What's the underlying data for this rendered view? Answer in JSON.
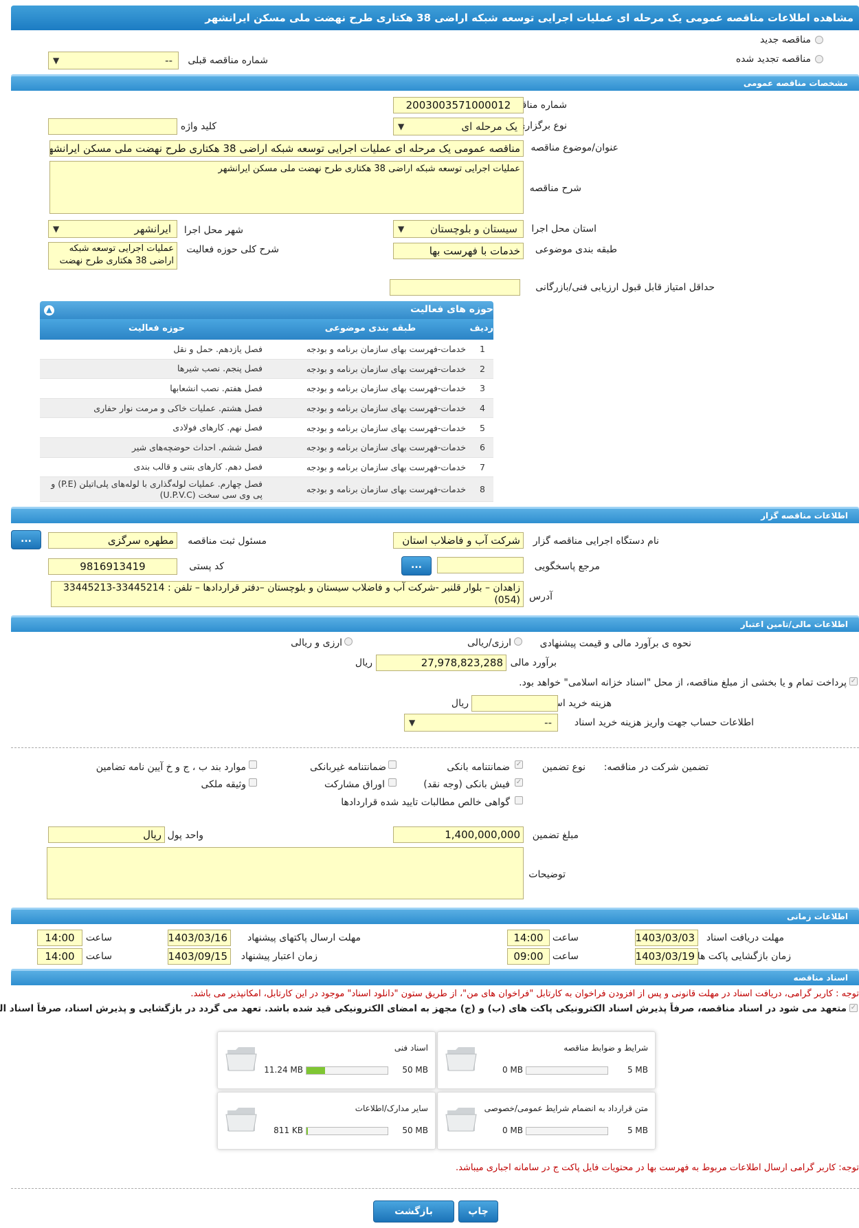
{
  "title": "مشاهده اطلاعات مناقصه عمومی یک مرحله ای عملیات اجرایی توسعه شبکه اراضی 38 هکتاری طرح نهضت ملی مسکن ایرانشهر",
  "top": {
    "new_tender": "مناقصه جدید",
    "renewed_tender": "مناقصه تجدید شده",
    "prev_number_label": "شماره مناقصه قبلی",
    "prev_number_value": "--"
  },
  "general": {
    "header": "مشخصات مناقصه عمومی",
    "number_label": "شماره مناقصه",
    "number_value": "2003003571000012",
    "type_label": "نوع برگزاری",
    "type_value": "یک مرحله ای",
    "keyword_label": "کلید واژه",
    "keyword_value": "",
    "subject_label": "عنوان/موضوع مناقصه",
    "subject_value": "مناقصه عمومی یک مرحله ای عملیات اجرایی توسعه شبکه اراضی 38 هکتاری طرح نهضت ملی مسکن ایرانشهر",
    "desc_label": "شرح مناقصه",
    "desc_value": "عملیات اجرایی توسعه شبکه اراضی 38 هکتاری طرح نهضت ملی مسکن ایرانشهر",
    "province_label": "استان محل اجرا",
    "province_value": "سیستان و بلوچستان",
    "city_label": "شهر محل اجرا",
    "city_value": "ایرانشهر",
    "category_label": "طبقه بندی موضوعی",
    "category_value": "خدمات با فهرست بها",
    "activity_desc_label": "شرح کلی حوزه فعالیت",
    "activity_desc_value": "عملیات اجرایی توسعه شبکه اراضی 38 هکتاری طرح نهضت",
    "min_score_label": "حداقل امتیاز قابل قبول ارزیابی فنی/بازرگانی",
    "min_score_value": ""
  },
  "activities": {
    "caption": "حوزه های فعالیت",
    "col_row": "ردیف",
    "col_category": "طبقه بندی موضوعی",
    "col_area": "حوزه فعالیت",
    "rows": [
      {
        "n": "1",
        "category": "خدمات-فهرست بهای سازمان برنامه و بودجه",
        "area": "فصل یازدهم. حمل و نقل"
      },
      {
        "n": "2",
        "category": "خدمات-فهرست بهای سازمان برنامه و بودجه",
        "area": "فصل پنجم. نصب شیرها"
      },
      {
        "n": "3",
        "category": "خدمات-فهرست بهای سازمان برنامه و بودجه",
        "area": "فصل هفتم. نصب انشعابها"
      },
      {
        "n": "4",
        "category": "خدمات-فهرست بهای سازمان برنامه و بودجه",
        "area": "فصل هشتم. عملیات خاکی و مرمت نوار حفاری"
      },
      {
        "n": "5",
        "category": "خدمات-فهرست بهای سازمان برنامه و بودجه",
        "area": "فصل نهم. کارهای فولادی"
      },
      {
        "n": "6",
        "category": "خدمات-فهرست بهای سازمان برنامه و بودجه",
        "area": "فصل ششم. احداث حوضچه‌های شیر"
      },
      {
        "n": "7",
        "category": "خدمات-فهرست بهای سازمان برنامه و بودجه",
        "area": "فصل دهم. کارهای بتنی و قالب بندی"
      },
      {
        "n": "8",
        "category": "خدمات-فهرست بهای سازمان برنامه و بودجه",
        "area": "فصل چهارم. عملیات لوله‌گذاری با لوله‌های پلی‌اتیلن (P.E) و پی وی سی سخت (U.P.V.C)"
      }
    ]
  },
  "organizer": {
    "header": "اطلاعات مناقصه گزار",
    "org_label": "نام دستگاه اجرایی مناقصه گزار",
    "org_value": "شرکت آب و فاضلاب استان",
    "responsible_label": "مسئول ثبت مناقصه",
    "responsible_value": "مطهره سرگزی",
    "ref_label": "مرجع پاسخگویی",
    "ref_value": "",
    "postal_label": "کد پستی",
    "postal_value": "9816913419",
    "address_label": "آدرس",
    "address_value": "زاهدان – بلوار قلنبر -شرکت آب و فاضلاب سیستان و بلوچستان –دفتر قراردادها –  تلفن : 33445214-33445213 (054)",
    "more_btn": "..."
  },
  "finance": {
    "header": "اطلاعات مالی/تامین اعتبار",
    "method_label": "نحوه ی برآورد مالی و قیمت پیشنهادی",
    "rial_option": "ارزی/ریالی",
    "fx_option": "ارزی و ریالی",
    "estimate_label": "برآورد مالی",
    "estimate_value": "27,978,823,288",
    "estimate_unit": "ریال",
    "treasury_note": "پرداخت تمام و یا بخشی از مبلغ مناقصه، از محل \"اسناد خزانه اسلامی\" خواهد بود.",
    "doc_cost_label": "هزینه خرید اسناد",
    "doc_cost_value": "",
    "doc_cost_unit": "ریال",
    "account_label": "اطلاعات حساب جهت واریز هزینه خرید اسناد",
    "account_value": "--"
  },
  "guarantee": {
    "label": "تضمین شرکت در مناقصه:",
    "type_label": "نوع تضمین",
    "opt_bank": "ضمانتنامه بانکی",
    "opt_nonbank": "ضمانتنامه غیربانکی",
    "opt_clauses": "موارد بند ب ، ج و خ آیین نامه تضامین",
    "opt_cash": "فیش بانکی (وجه نقد)",
    "opt_bonds": "اوراق مشارکت",
    "opt_property": "وثیقه ملکی",
    "opt_claims": "گواهی خالص مطالبات تایید شده قراردادها",
    "amount_label": "مبلغ تضمین",
    "amount_value": "1,400,000,000",
    "currency_label": "واحد پول",
    "currency_value": "ریال",
    "notes_label": "توضیحات",
    "notes_value": ""
  },
  "timing": {
    "header": "اطلاعات زمانی",
    "doc_receive_label": "مهلت دریافت اسناد",
    "doc_receive_date": "1403/03/03",
    "doc_receive_time": "14:00",
    "send_label": "مهلت ارسال پاکتهای پیشنهاد",
    "send_date": "1403/03/16",
    "send_time": "14:00",
    "open_label": "زمان بازگشایی پاکت ها",
    "open_date": "1403/03/19",
    "open_time": "09:00",
    "validity_label": "زمان اعتبار پیشنهاد",
    "validity_date": "1403/09/15",
    "validity_time": "14:00",
    "time_label": "ساعت"
  },
  "documents": {
    "header": "اسناد مناقصه",
    "note1": "توجه : کاربر گرامی، دریافت اسناد در مهلت قانونی و پس از افزودن فراخوان به کارتابل \"فراخوان های من\"، از طریق ستون \"دانلود اسناد\" موجود در این کارتابل، امکانپذیر می باشد.",
    "commitment": "متعهد می شود در اسناد مناقصه، صرفاً پذیرش اسناد الکترونیکی پاکت های (ب) و (ج) مجهز به امضای الکترونیکی قید شده باشد. تعهد می گردد در بازگشایی و پذیرش اسناد، صرفاً اسناد الکترونیکی پاکت های پیشنهاد (ب) و (ج) مجهز به امضای الکترونیکی صاحبان امضای مجاز مورد پذیرش واقع گردد.",
    "files": [
      {
        "name": "شرایط و ضوابط مناقصه",
        "used": "0 MB",
        "max": "5 MB",
        "fill": 0
      },
      {
        "name": "اسناد فنی",
        "used": "11.24 MB",
        "max": "50 MB",
        "fill": 0.2248
      },
      {
        "name": "متن قرارداد به انضمام شرایط عمومی/خصوصی",
        "used": "0 MB",
        "max": "5 MB",
        "fill": 0
      },
      {
        "name": "سایر مدارک/اطلاعات",
        "used": "811 KB",
        "max": "50 MB",
        "fill": 0.016
      }
    ],
    "note2": "توجه: کاربر گرامی ارسال اطلاعات مربوط به فهرست بها در محتویات فایل پاکت ج در سامانه اجباری میباشد."
  },
  "footer": {
    "print": "چاپ",
    "back": "بازگشت"
  },
  "colors": {
    "header_blue": "#2f8fd0",
    "field_yellow": "#ffffc6",
    "note_red": "#c00000"
  }
}
